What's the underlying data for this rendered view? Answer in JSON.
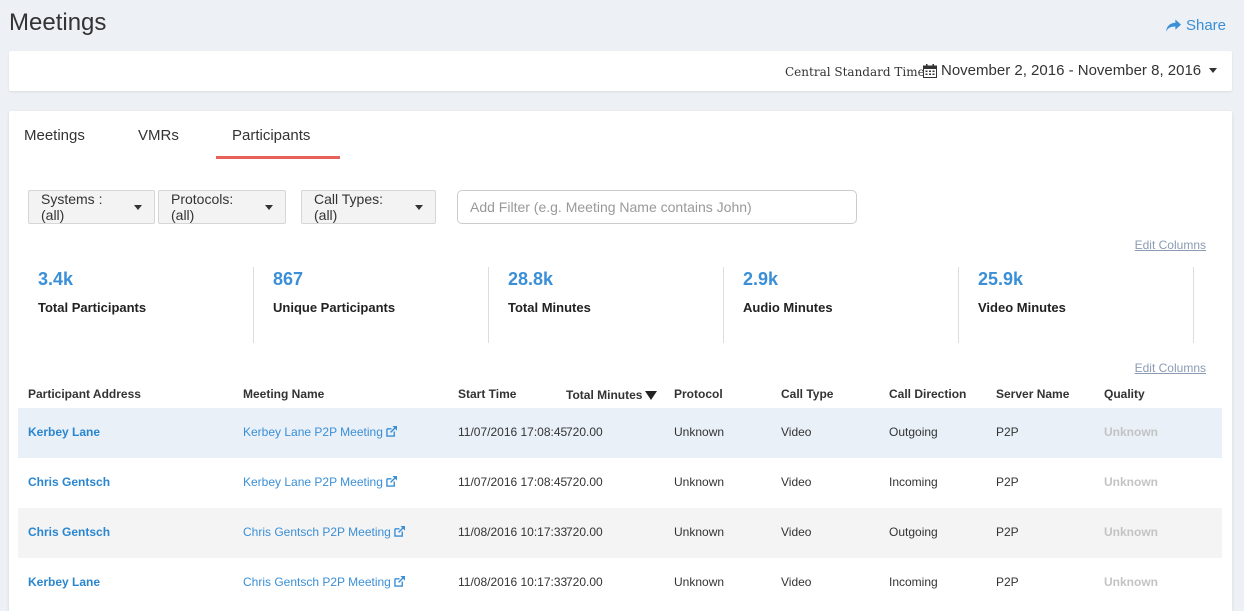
{
  "header": {
    "title": "Meetings",
    "share_label": "Share"
  },
  "datebar": {
    "timezone": "Central Standard Time",
    "date_range": "November 2, 2016 - November 8, 2016"
  },
  "tabs": [
    {
      "label": "Meetings",
      "active": false
    },
    {
      "label": "VMRs",
      "active": false
    },
    {
      "label": "Participants",
      "active": true
    }
  ],
  "filters": {
    "systems_label": "Systems : (all)",
    "protocols_label": "Protocols: (all)",
    "call_types_label": "Call Types: (all)",
    "search_placeholder": "Add Filter (e.g. Meeting Name contains John)"
  },
  "edit_columns_label": "Edit Columns",
  "stats": [
    {
      "value": "3.4k",
      "label": "Total Participants"
    },
    {
      "value": "867",
      "label": "Unique Participants"
    },
    {
      "value": "28.8k",
      "label": "Total Minutes"
    },
    {
      "value": "2.9k",
      "label": "Audio Minutes"
    },
    {
      "value": "25.9k",
      "label": "Video Minutes"
    }
  ],
  "table": {
    "columns": [
      "Participant Address",
      "Meeting Name",
      "Start Time",
      "Total Minutes",
      "Protocol",
      "Call Type",
      "Call Direction",
      "Server Name",
      "Quality"
    ],
    "rows": [
      {
        "participant": "Kerbey Lane",
        "meeting": "Kerbey Lane P2P Meeting",
        "start": "11/07/2016 17:08:45",
        "minutes": "720.00",
        "protocol": "Unknown",
        "call_type": "Video",
        "direction": "Outgoing",
        "server": "P2P",
        "quality": "Unknown"
      },
      {
        "participant": "Chris Gentsch",
        "meeting": "Kerbey Lane P2P Meeting",
        "start": "11/07/2016 17:08:45",
        "minutes": "720.00",
        "protocol": "Unknown",
        "call_type": "Video",
        "direction": "Incoming",
        "server": "P2P",
        "quality": "Unknown"
      },
      {
        "participant": "Chris Gentsch",
        "meeting": "Chris Gentsch P2P Meeting",
        "start": "11/08/2016 10:17:33",
        "minutes": "720.00",
        "protocol": "Unknown",
        "call_type": "Video",
        "direction": "Outgoing",
        "server": "P2P",
        "quality": "Unknown"
      },
      {
        "participant": "Kerbey Lane",
        "meeting": "Chris Gentsch P2P Meeting",
        "start": "11/08/2016 10:17:33",
        "minutes": "720.00",
        "protocol": "Unknown",
        "call_type": "Video",
        "direction": "Incoming",
        "server": "P2P",
        "quality": "Unknown"
      }
    ]
  },
  "colors": {
    "accent": "#3a8fd6",
    "tab_underline": "#e5615a",
    "background": "#edf0f4"
  }
}
